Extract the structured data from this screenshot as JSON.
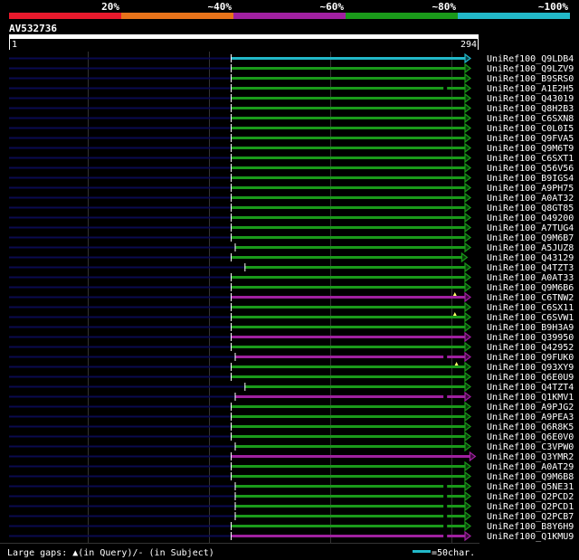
{
  "chart_data": {
    "type": "alignment",
    "query_id": "AV532736",
    "query_range": [
      1,
      294
    ],
    "identity_scale": {
      "labels": [
        "20%",
        "~40%",
        "~60%",
        "~80%",
        "~100%"
      ],
      "colors": [
        "#e8192c",
        "#e8731a",
        "#a020a0",
        "#1a9a1a",
        "#22b8c8"
      ]
    },
    "gap_colors": {
      "subject_extension": "#0a0a50",
      "dashed_gap": "#000000"
    },
    "legend": {
      "gaps_text": "Large gaps: ▲(in Query)/- (in Subject)",
      "scale_text": "=50char.",
      "scale_color": "#22b8c8"
    },
    "hits": [
      {
        "label": "UniRef100_Q9LDB4",
        "start": 1,
        "end": 294,
        "color": "#22b8c8",
        "marks": []
      },
      {
        "label": "UniRef100_Q9LZV9",
        "start": 1,
        "end": 294,
        "color": "#1a9a1a",
        "marks": []
      },
      {
        "label": "UniRef100_B9SRS0",
        "start": 1,
        "end": 294,
        "color": "#1a9a1a",
        "marks": []
      },
      {
        "label": "UniRef100_A1E2H5",
        "start": 1,
        "end": 294,
        "color": "#1a9a1a",
        "marks": [
          {
            "type": "gap",
            "pos": 262
          }
        ]
      },
      {
        "label": "UniRef100_Q43019",
        "start": 1,
        "end": 294,
        "color": "#1a9a1a",
        "marks": []
      },
      {
        "label": "UniRef100_Q8H2B3",
        "start": 1,
        "end": 294,
        "color": "#1a9a1a",
        "marks": []
      },
      {
        "label": "UniRef100_C6SXN8",
        "start": 1,
        "end": 294,
        "color": "#1a9a1a",
        "marks": []
      },
      {
        "label": "UniRef100_C0L0I5",
        "start": 1,
        "end": 294,
        "color": "#1a9a1a",
        "marks": []
      },
      {
        "label": "UniRef100_Q9FVA5",
        "start": 1,
        "end": 294,
        "color": "#1a9a1a",
        "marks": []
      },
      {
        "label": "UniRef100_Q9M6T9",
        "start": 1,
        "end": 294,
        "color": "#1a9a1a",
        "marks": []
      },
      {
        "label": "UniRef100_C6SXT1",
        "start": 1,
        "end": 294,
        "color": "#1a9a1a",
        "marks": []
      },
      {
        "label": "UniRef100_Q56V56",
        "start": 1,
        "end": 294,
        "color": "#1a9a1a",
        "marks": []
      },
      {
        "label": "UniRef100_B9IGS4",
        "start": 1,
        "end": 294,
        "color": "#1a9a1a",
        "marks": []
      },
      {
        "label": "UniRef100_A9PH75",
        "start": 1,
        "end": 294,
        "color": "#1a9a1a",
        "marks": []
      },
      {
        "label": "UniRef100_A0AT32",
        "start": 1,
        "end": 294,
        "color": "#1a9a1a",
        "marks": []
      },
      {
        "label": "UniRef100_Q8GT85",
        "start": 1,
        "end": 294,
        "color": "#1a9a1a",
        "marks": []
      },
      {
        "label": "UniRef100_O49200",
        "start": 1,
        "end": 294,
        "color": "#1a9a1a",
        "marks": []
      },
      {
        "label": "UniRef100_A7TUG4",
        "start": 1,
        "end": 294,
        "color": "#1a9a1a",
        "marks": []
      },
      {
        "label": "UniRef100_Q9M6B7",
        "start": 1,
        "end": 294,
        "color": "#1a9a1a",
        "marks": []
      },
      {
        "label": "UniRef100_A5JUZ8",
        "start": 6,
        "end": 294,
        "color": "#1a9a1a",
        "marks": []
      },
      {
        "label": "UniRef100_Q43129",
        "start": 1,
        "end": 290,
        "color": "#1a9a1a",
        "marks": []
      },
      {
        "label": "UniRef100_Q4TZT3",
        "start": 18,
        "end": 294,
        "color": "#1a9a1a",
        "marks": []
      },
      {
        "label": "UniRef100_A0AT33",
        "start": 1,
        "end": 294,
        "color": "#1a9a1a",
        "marks": []
      },
      {
        "label": "UniRef100_Q9M6B6",
        "start": 1,
        "end": 294,
        "color": "#1a9a1a",
        "marks": []
      },
      {
        "label": "UniRef100_C6TNW2",
        "start": 1,
        "end": 294,
        "color": "#a020a0",
        "marks": [
          {
            "type": "query",
            "pos": 276
          }
        ]
      },
      {
        "label": "UniRef100_C6SX11",
        "start": 1,
        "end": 294,
        "color": "#1a9a1a",
        "marks": []
      },
      {
        "label": "UniRef100_C6SVW1",
        "start": 1,
        "end": 294,
        "color": "#1a9a1a",
        "marks": [
          {
            "type": "query",
            "pos": 276
          }
        ]
      },
      {
        "label": "UniRef100_B9H3A9",
        "start": 1,
        "end": 294,
        "color": "#1a9a1a",
        "marks": []
      },
      {
        "label": "UniRef100_Q39950",
        "start": 1,
        "end": 294,
        "color": "#a020a0",
        "marks": []
      },
      {
        "label": "UniRef100_Q42952",
        "start": 1,
        "end": 294,
        "color": "#1a9a1a",
        "marks": []
      },
      {
        "label": "UniRef100_Q9FUK0",
        "start": 6,
        "end": 294,
        "color": "#a020a0",
        "marks": [
          {
            "type": "gap",
            "pos": 262
          }
        ]
      },
      {
        "label": "UniRef100_Q93XY9",
        "start": 1,
        "end": 294,
        "color": "#1a9a1a",
        "marks": [
          {
            "type": "query",
            "pos": 278
          }
        ]
      },
      {
        "label": "UniRef100_Q6E0U9",
        "start": 1,
        "end": 294,
        "color": "#1a9a1a",
        "marks": []
      },
      {
        "label": "UniRef100_Q4TZT4",
        "start": 18,
        "end": 294,
        "color": "#1a9a1a",
        "marks": []
      },
      {
        "label": "UniRef100_Q1KMV1",
        "start": 6,
        "end": 294,
        "color": "#a020a0",
        "marks": [
          {
            "type": "gap",
            "pos": 262
          }
        ]
      },
      {
        "label": "UniRef100_A9PJG2",
        "start": 1,
        "end": 294,
        "color": "#1a9a1a",
        "marks": []
      },
      {
        "label": "UniRef100_A9PEA3",
        "start": 1,
        "end": 294,
        "color": "#1a9a1a",
        "marks": []
      },
      {
        "label": "UniRef100_Q6R8K5",
        "start": 1,
        "end": 294,
        "color": "#1a9a1a",
        "marks": []
      },
      {
        "label": "UniRef100_Q6E0V0",
        "start": 1,
        "end": 294,
        "color": "#1a9a1a",
        "marks": []
      },
      {
        "label": "UniRef100_C3VPW0",
        "start": 6,
        "end": 294,
        "color": "#1a9a1a",
        "marks": []
      },
      {
        "label": "UniRef100_Q3YMR2",
        "start": 1,
        "end": 300,
        "color": "#a020a0",
        "marks": []
      },
      {
        "label": "UniRef100_A0AT29",
        "start": 1,
        "end": 294,
        "color": "#1a9a1a",
        "marks": []
      },
      {
        "label": "UniRef100_Q9M6B8",
        "start": 1,
        "end": 294,
        "color": "#1a9a1a",
        "marks": []
      },
      {
        "label": "UniRef100_Q5NE31",
        "start": 6,
        "end": 294,
        "color": "#1a9a1a",
        "marks": [
          {
            "type": "gap",
            "pos": 262
          }
        ]
      },
      {
        "label": "UniRef100_Q2PCD2",
        "start": 6,
        "end": 294,
        "color": "#1a9a1a",
        "marks": [
          {
            "type": "gap",
            "pos": 262
          }
        ]
      },
      {
        "label": "UniRef100_Q2PCD1",
        "start": 6,
        "end": 294,
        "color": "#1a9a1a",
        "marks": [
          {
            "type": "gap",
            "pos": 262
          }
        ]
      },
      {
        "label": "UniRef100_Q2PCB7",
        "start": 6,
        "end": 294,
        "color": "#1a9a1a",
        "marks": [
          {
            "type": "gap",
            "pos": 262
          }
        ]
      },
      {
        "label": "UniRef100_B8Y6H9",
        "start": 1,
        "end": 294,
        "color": "#1a9a1a",
        "marks": [
          {
            "type": "gap",
            "pos": 262
          }
        ]
      },
      {
        "label": "UniRef100_Q1KMU9",
        "start": 1,
        "end": 294,
        "color": "#a020a0",
        "marks": [
          {
            "type": "gap",
            "pos": 262
          }
        ]
      }
    ]
  }
}
